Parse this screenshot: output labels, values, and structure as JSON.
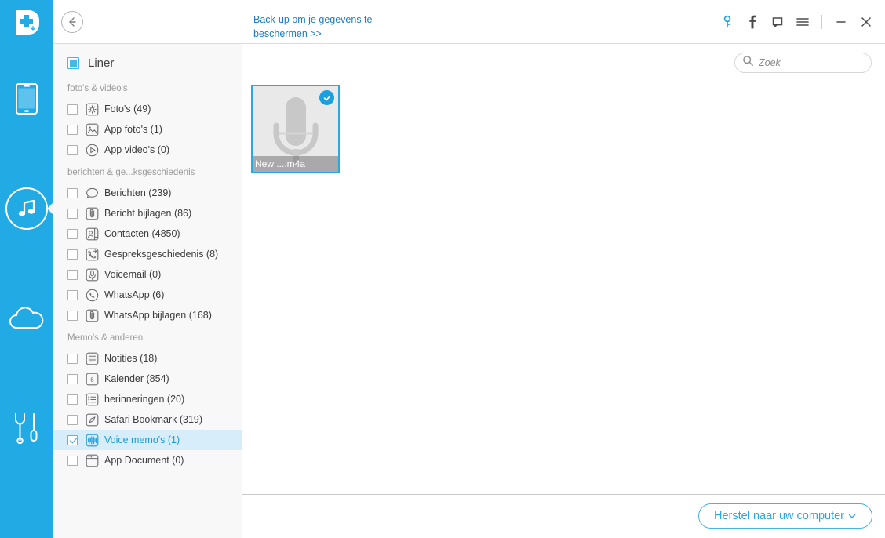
{
  "app": {
    "logo_icon": "drfone-logo-icon",
    "brand_blue": "#22aae4"
  },
  "titlebar": {
    "back_icon": "back-arrow-icon",
    "promo_link": "Back-up om je gegevens te beschermen >>",
    "actions": [
      {
        "icon": "key-icon",
        "name": "register-key-icon"
      },
      {
        "icon": "facebook-icon",
        "name": "facebook-icon"
      },
      {
        "icon": "feedback-icon",
        "name": "feedback-icon"
      },
      {
        "icon": "menu-icon",
        "name": "hamburger-menu-icon"
      }
    ],
    "minimize_icon": "minimize-icon",
    "close_icon": "close-icon"
  },
  "rail": {
    "items": [
      {
        "name": "rail-item-phone",
        "icon": "phone-icon",
        "active": false
      },
      {
        "name": "rail-item-music",
        "icon": "music-note-icon",
        "active": true
      },
      {
        "name": "rail-item-cloud",
        "icon": "cloud-icon",
        "active": false
      },
      {
        "name": "rail-item-tools",
        "icon": "wrench-screwdriver-icon",
        "active": false
      }
    ]
  },
  "sidebar": {
    "device_name": "Liner",
    "device_checkbox_state": "indeterminate",
    "groups": [
      {
        "title": "foto's & video's",
        "items": [
          {
            "label": "Foto's (49)",
            "icon": "photos-icon",
            "checked": false,
            "selected": false
          },
          {
            "label": "App foto's (1)",
            "icon": "app-photos-icon",
            "checked": false,
            "selected": false
          },
          {
            "label": "App video's (0)",
            "icon": "app-videos-icon",
            "checked": false,
            "selected": false
          }
        ]
      },
      {
        "title": "berichten & ge...ksgeschiedenis",
        "items": [
          {
            "label": "Berichten (239)",
            "icon": "messages-icon",
            "checked": false,
            "selected": false
          },
          {
            "label": "Bericht bijlagen (86)",
            "icon": "attachment-icon",
            "checked": false,
            "selected": false
          },
          {
            "label": "Contacten (4850)",
            "icon": "contacts-icon",
            "checked": false,
            "selected": false
          },
          {
            "label": "Gespreksgeschiedenis (8)",
            "icon": "call-history-icon",
            "checked": false,
            "selected": false
          },
          {
            "label": "Voicemail (0)",
            "icon": "voicemail-icon",
            "checked": false,
            "selected": false
          },
          {
            "label": "WhatsApp (6)",
            "icon": "whatsapp-icon",
            "checked": false,
            "selected": false
          },
          {
            "label": "WhatsApp bijlagen (168)",
            "icon": "attachment-icon",
            "checked": false,
            "selected": false
          }
        ]
      },
      {
        "title": "Memo's & anderen",
        "items": [
          {
            "label": "Notities (18)",
            "icon": "notes-icon",
            "checked": false,
            "selected": false
          },
          {
            "label": "Kalender (854)",
            "icon": "calendar-icon",
            "checked": false,
            "selected": false
          },
          {
            "label": "herinneringen (20)",
            "icon": "reminders-icon",
            "checked": false,
            "selected": false
          },
          {
            "label": "Safari Bookmark (319)",
            "icon": "safari-icon",
            "checked": false,
            "selected": false
          },
          {
            "label": "Voice memo's (1)",
            "icon": "voice-memo-icon",
            "checked": true,
            "selected": true
          },
          {
            "label": "App Document (0)",
            "icon": "app-document-icon",
            "checked": false,
            "selected": false
          }
        ]
      }
    ]
  },
  "main": {
    "search": {
      "placeholder": "Zoek",
      "value": "",
      "icon": "search-icon"
    },
    "tiles": [
      {
        "caption": "New ....m4a",
        "icon": "microphone-icon",
        "selected": true,
        "check_icon": "check-circle-icon"
      }
    ]
  },
  "bottombar": {
    "restore_label": "Herstel naar uw computer",
    "restore_caret_icon": "chevron-down-icon"
  }
}
